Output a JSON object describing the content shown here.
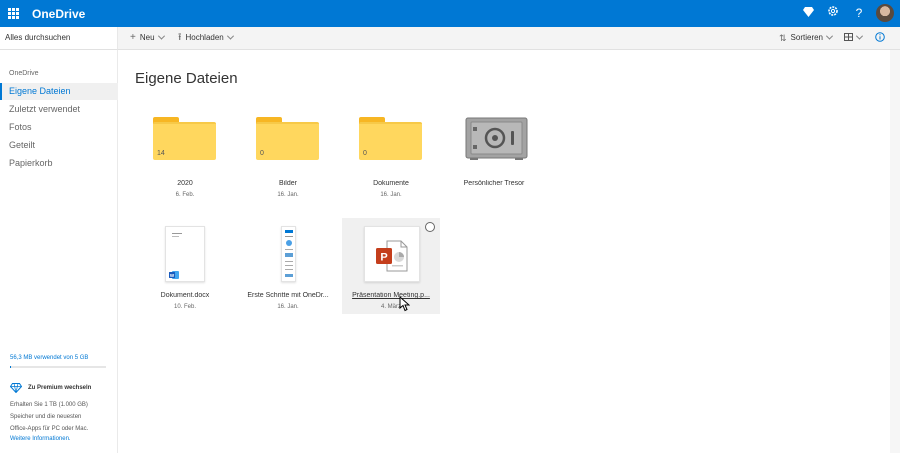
{
  "topbar": {
    "brand": "OneDrive",
    "icons": [
      "waffle-icon",
      "premium-diamond-icon",
      "settings-gear-icon",
      "help-icon",
      "user-avatar"
    ]
  },
  "search": {
    "placeholder": "Alles durchsuchen"
  },
  "commands": {
    "new_label": "Neu",
    "upload_label": "Hochladen",
    "sort_label": "Sortieren"
  },
  "sidebar": {
    "header": "OneDrive",
    "items": [
      {
        "label": "Eigene Dateien",
        "active": true
      },
      {
        "label": "Zuletzt verwendet",
        "active": false
      },
      {
        "label": "Fotos",
        "active": false
      },
      {
        "label": "Geteilt",
        "active": false
      },
      {
        "label": "Papierkorb",
        "active": false
      }
    ],
    "storage_text": "56,3 MB verwendet von 5 GB",
    "storage_fraction": 0.011,
    "premium_label": "Zu Premium wechseln",
    "premium_desc": [
      "Erhalten Sie 1 TB (1.000 GB)",
      "Speicher und die neuesten",
      "Office-Apps für PC oder Mac."
    ],
    "more_link": "Weitere Informationen."
  },
  "main": {
    "title": "Eigene Dateien",
    "folders": [
      {
        "name": "2020",
        "date": "6. Feb.",
        "count": "14"
      },
      {
        "name": "Bilder",
        "date": "16. Jan.",
        "count": "0"
      },
      {
        "name": "Dokumente",
        "date": "16. Jan.",
        "count": "0"
      },
      {
        "name": "Persönlicher Tresor",
        "date": "",
        "count": ""
      }
    ],
    "files": [
      {
        "name": "Dokument.docx",
        "date": "10. Feb."
      },
      {
        "name": "Erste Schritte mit OneDr...",
        "date": "16. Jan."
      },
      {
        "name": "Präsentation Meeting.p...",
        "date": "4. März",
        "selected": true
      }
    ]
  },
  "colors": {
    "accent": "#0078d4",
    "folder": "#ffd75e",
    "powerpoint": "#c43e1c",
    "word": "#185abd"
  }
}
